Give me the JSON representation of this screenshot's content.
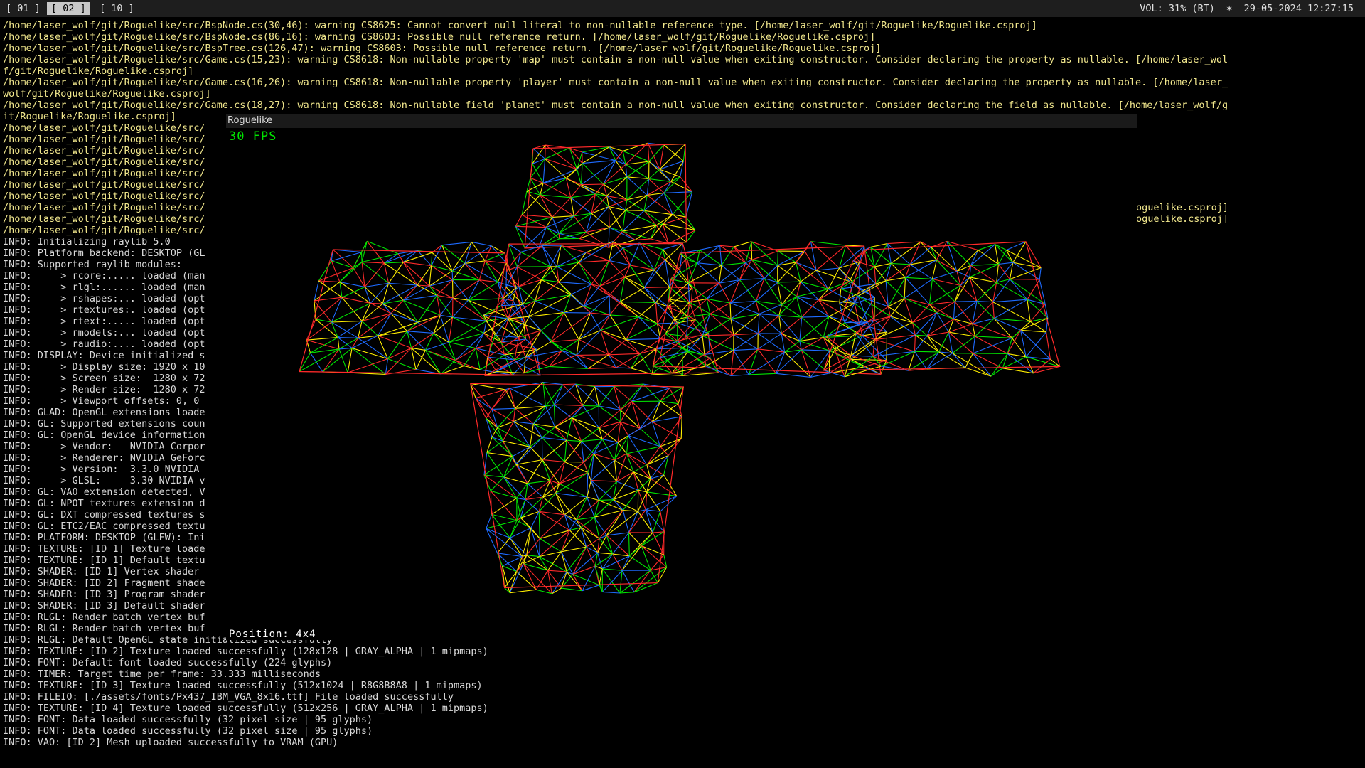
{
  "topbar": {
    "workspaces": [
      "[ 01 ]",
      "[ 02 ]",
      "[ 10 ]"
    ],
    "status": "VOL: 31% (BT)  ✶  29-05-2024 12:27:15"
  },
  "terminal": {
    "warnings": [
      "/home/laser_wolf/git/Roguelike/src/BspNode.cs(30,46): warning CS8625: Cannot convert null literal to non-nullable reference type. [/home/laser_wolf/git/Roguelike/Roguelike.csproj]",
      "/home/laser_wolf/git/Roguelike/src/BspNode.cs(86,16): warning CS8603: Possible null reference return. [/home/laser_wolf/git/Roguelike/Roguelike.csproj]",
      "/home/laser_wolf/git/Roguelike/src/BspTree.cs(126,47): warning CS8603: Possible null reference return. [/home/laser_wolf/git/Roguelike/Roguelike.csproj]",
      "/home/laser_wolf/git/Roguelike/src/Game.cs(15,23): warning CS8618: Non-nullable property 'map' must contain a non-null value when exiting constructor. Consider declaring the property as nullable. [/home/laser_wol",
      "f/git/Roguelike/Roguelike.csproj]",
      "/home/laser_wolf/git/Roguelike/src/Game.cs(16,26): warning CS8618: Non-nullable property 'player' must contain a non-null value when exiting constructor. Consider declaring the property as nullable. [/home/laser_",
      "wolf/git/Roguelike/Roguelike.csproj]",
      "/home/laser_wolf/git/Roguelike/src/Game.cs(18,27): warning CS8618: Non-nullable field 'planet' must contain a non-null value when exiting constructor. Consider declaring the field as nullable. [/home/laser_wolf/g",
      "it/Roguelike/Roguelike.csproj]",
      "/home/laser_wolf/git/Roguelike/src/",
      "/home/laser_wolf/git/Roguelike/src/",
      "/home/laser_wolf/git/Roguelike/src/",
      "/home/laser_wolf/git/Roguelike/src/",
      "/home/laser_wolf/git/Roguelike/src/",
      "/home/laser_wolf/git/Roguelike/src/",
      "/home/laser_wolf/git/Roguelike/src/",
      "/home/laser_wolf/git/Roguelike/src/",
      "/home/laser_wolf/git/Roguelike/src/",
      "/home/laser_wolf/git/Roguelike/src/"
    ],
    "right_fragments": [
      "oguelike.csproj]",
      "oguelike.csproj]"
    ],
    "info": [
      "INFO: Initializing raylib 5.0",
      "INFO: Platform backend: DESKTOP (GL",
      "INFO: Supported raylib modules:",
      "INFO:     > rcore:..... loaded (man",
      "INFO:     > rlgl:...... loaded (man",
      "INFO:     > rshapes:... loaded (opt",
      "INFO:     > rtextures:. loaded (opt",
      "INFO:     > rtext:..... loaded (opt",
      "INFO:     > rmodels:... loaded (opt",
      "INFO:     > raudio:.... loaded (opt",
      "INFO: DISPLAY: Device initialized s",
      "INFO:     > Display size: 1920 x 10",
      "INFO:     > Screen size:  1280 x 72",
      "INFO:     > Render size:  1280 x 72",
      "INFO:     > Viewport offsets: 0, 0",
      "INFO: GLAD: OpenGL extensions loade",
      "INFO: GL: Supported extensions coun",
      "INFO: GL: OpenGL device information",
      "INFO:     > Vendor:   NVIDIA Corpor",
      "INFO:     > Renderer: NVIDIA GeForc",
      "INFO:     > Version:  3.3.0 NVIDIA",
      "INFO:     > GLSL:     3.30 NVIDIA v",
      "INFO: GL: VAO extension detected, V",
      "INFO: GL: NPOT textures extension d",
      "INFO: GL: DXT compressed textures s",
      "INFO: GL: ETC2/EAC compressed textu",
      "INFO: PLATFORM: DESKTOP (GLFW): Ini",
      "INFO: TEXTURE: [ID 1] Texture loade",
      "INFO: TEXTURE: [ID 1] Default textu",
      "INFO: SHADER: [ID 1] Vertex shader",
      "INFO: SHADER: [ID 2] Fragment shade",
      "INFO: SHADER: [ID 3] Program shader",
      "INFO: SHADER: [ID 3] Default shader",
      "INFO: RLGL: Render batch vertex buf",
      "INFO: RLGL: Render batch vertex buf",
      "INFO: RLGL: Default OpenGL state initialized successfully",
      "INFO: TEXTURE: [ID 2] Texture loaded successfully (128x128 | GRAY_ALPHA | 1 mipmaps)",
      "INFO: FONT: Default font loaded successfully (224 glyphs)",
      "INFO: TIMER: Target time per frame: 33.333 milliseconds",
      "INFO: TEXTURE: [ID 3] Texture loaded successfully (512x1024 | R8G8B8A8 | 1 mipmaps)",
      "INFO: FILEIO: [./assets/fonts/Px437_IBM_VGA_8x16.ttf] File loaded successfully",
      "INFO: TEXTURE: [ID 4] Texture loaded successfully (512x256 | GRAY_ALPHA | 1 mipmaps)",
      "INFO: FONT: Data loaded successfully (32 pixel size | 95 glyphs)",
      "INFO: FONT: Data loaded successfully (32 pixel size | 95 glyphs)",
      "INFO: VAO: [ID 2] Mesh uploaded successfully to VRAM (GPU)"
    ]
  },
  "raylib_window": {
    "title": "Roguelike",
    "fps": "30 FPS",
    "position": "Position: 4x4",
    "mesh_colors": [
      "#ff2a2a",
      "#00e400",
      "#ffee00",
      "#1e6bff"
    ]
  }
}
